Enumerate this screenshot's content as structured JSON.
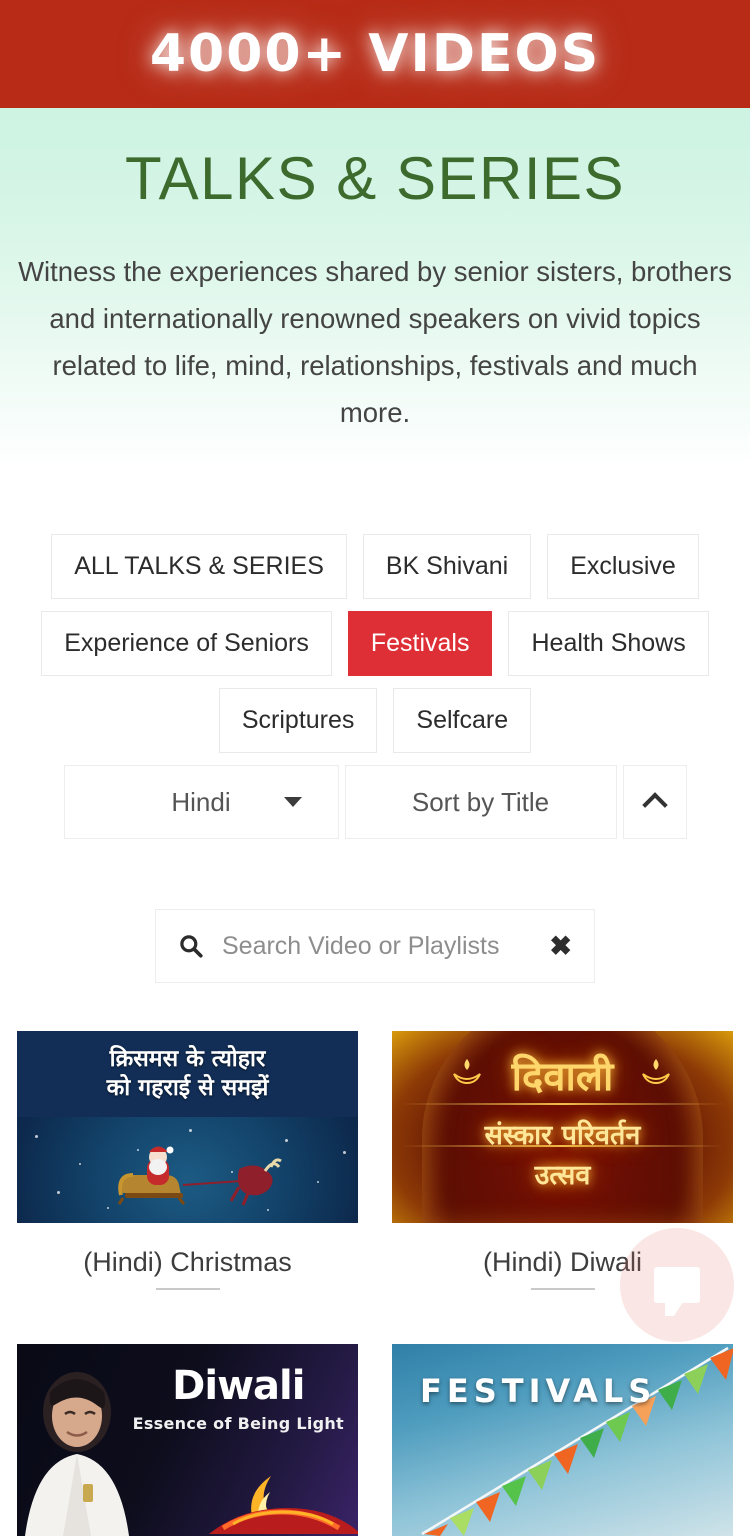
{
  "banner": {
    "text": "4000+ VIDEOS",
    "background_color": "#b72b17"
  },
  "hero": {
    "title": "TALKS & SERIES",
    "title_color": "#3d6b2e",
    "description": "Witness the experiences shared by senior sisters, brothers and internationally renowned speakers on vivid topics related to life, mind, relationships, festivals and much more."
  },
  "filters": {
    "active_color": "#dd2f35",
    "rows": [
      [
        {
          "label": "ALL TALKS & SERIES",
          "active": false
        },
        {
          "label": "BK Shivani",
          "active": false
        },
        {
          "label": "Exclusive",
          "active": false
        }
      ],
      [
        {
          "label": "Experience of Seniors",
          "active": false
        },
        {
          "label": "Festivals",
          "active": true
        },
        {
          "label": "Health Shows",
          "active": false
        }
      ],
      [
        {
          "label": "Scriptures",
          "active": false
        },
        {
          "label": "Selfcare",
          "active": false
        }
      ]
    ]
  },
  "controls": {
    "language": {
      "value": "Hindi",
      "icon": "chevron-down-icon"
    },
    "sort": {
      "value": "Sort by Title"
    },
    "sort_direction": {
      "icon": "chevron-up-icon",
      "value": "ascending"
    }
  },
  "search": {
    "placeholder": "Search Video or Playlists",
    "value": "",
    "icon": "search-icon",
    "clear_icon": "close-icon",
    "clear_label": "✖"
  },
  "videos": [
    {
      "title": "(Hindi) Christmas",
      "thumbnail_type": "christmas",
      "thumbnail_text": [
        "क्रिसमस के त्योहार",
        "को गहराई से समझें"
      ]
    },
    {
      "title": "(Hindi) Diwali",
      "thumbnail_type": "diwali-gold",
      "thumbnail_text": [
        "दिवाली",
        "संस्कार परिवर्तन",
        "उत्सव"
      ]
    },
    {
      "title": "",
      "thumbnail_type": "diwali-essence",
      "thumbnail_text": [
        "Diwali",
        "Essence of Being Light"
      ]
    },
    {
      "title": "",
      "thumbnail_type": "festivals",
      "thumbnail_text": [
        "FESTIVALS"
      ]
    }
  ],
  "chat": {
    "icon": "chat-bubble-icon",
    "background_color": "#e4786e"
  }
}
